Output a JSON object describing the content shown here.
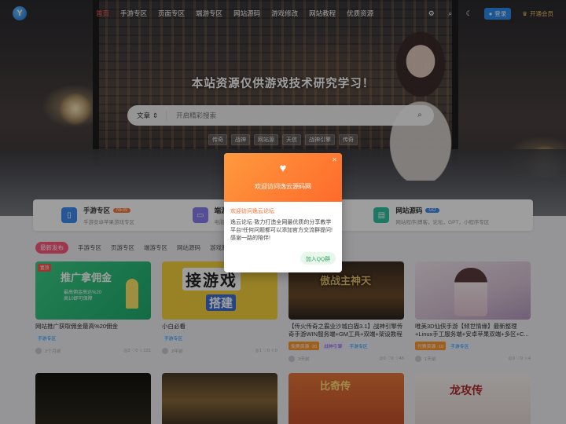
{
  "header": {
    "nav": [
      "首页",
      "手游专区",
      "页面专区",
      "端游专区",
      "网站源码",
      "游戏修改",
      "网站教程",
      "优质资源"
    ],
    "login_label": "登录",
    "vip_label": "开通会员"
  },
  "hero": {
    "slogan": "本站资源仅供游戏技术研究学习！",
    "search_type": "文章",
    "search_placeholder": "开启精彩搜索",
    "hot_tags": [
      "传奇",
      "战神",
      "网站源",
      "天信",
      "战神引擎",
      "传奇"
    ]
  },
  "categories": [
    {
      "title": "手游专区",
      "badge": "NEW",
      "sub": "手游安卓苹果游戏专区",
      "icon": "phone-icon",
      "color": "#3c8cf0",
      "badge_color": "#ff7a3a"
    },
    {
      "title": "端游专区",
      "badge": "",
      "sub": "电脑pc端游专区",
      "icon": "monitor-icon",
      "color": "#8a7cf0",
      "badge_color": ""
    },
    {
      "title": "网站源码",
      "badge": "GO",
      "sub": "网站程序|博客，论坛，GPT，小程序专区",
      "icon": "code-icon",
      "color": "#2fc4a0",
      "badge_color": "#3c8cf0"
    }
  ],
  "tabs": [
    "最新发布",
    "手游专区",
    "页游专区",
    "端游专区",
    "网站源码",
    "游戏教程"
  ],
  "posts": [
    {
      "badge": "置顶",
      "thumb_text": "推广拿佣金",
      "thumb_sub": "最高佣金高达%20\n高10即可保障",
      "title": "网站推广获取佣金最高%20佣金",
      "tags": [
        {
          "text": "手游专区",
          "style": "blue"
        }
      ],
      "author": "2个月前",
      "stats": "◎3 ♡0 ☆131"
    },
    {
      "badge": "",
      "thumb_text": "接游戏",
      "thumb_sub": "搭建",
      "title": "小白必看",
      "tags": [
        {
          "text": "手游专区",
          "style": "blue"
        }
      ],
      "author": "2年前",
      "stats": "◎1 ♡0 ☆0"
    },
    {
      "badge": "",
      "thumb_text": "傲战主神天",
      "thumb_sub": "",
      "title": "【传火传奇之霸业沙城白猫3.1】战神引擎传奇手游WIN服务端+GM工具+双端+架设教程",
      "tags": [
        {
          "text": "免费资源 ·20",
          "style": "orange"
        },
        {
          "text": "战神引擎",
          "style": "purple"
        },
        {
          "text": "手游专区",
          "style": "blue"
        }
      ],
      "author": "3天前",
      "stats": "◎0 ♡0 ☆45"
    },
    {
      "badge": "",
      "thumb_text": "",
      "thumb_sub": "",
      "title": "唯美3D仙侠手游【倾世情缘】最新整理+Linux手工服务端+安卓苹果双端+多区+C...",
      "tags": [
        {
          "text": "付费资源 ·10",
          "style": "orange"
        },
        {
          "text": "手游专区",
          "style": "blue"
        }
      ],
      "author": "1天前",
      "stats": "◎0 ♡0 ☆4"
    },
    {
      "badge": "",
      "thumb_text": "",
      "thumb_sub": "",
      "title": "",
      "tags": [],
      "author": "",
      "stats": ""
    },
    {
      "badge": "",
      "thumb_text": "",
      "thumb_sub": "",
      "title": "",
      "tags": [],
      "author": "",
      "stats": ""
    },
    {
      "badge": "",
      "thumb_text": "比奇传",
      "thumb_sub": "",
      "title": "",
      "tags": [],
      "author": "",
      "stats": ""
    },
    {
      "badge": "",
      "thumb_text": "龙攻传",
      "thumb_sub": "",
      "title": "",
      "tags": [],
      "author": "",
      "stats": ""
    }
  ],
  "modal": {
    "title": "欢迎访问逸云源码网",
    "subtitle": "欢迎访问逸云论坛",
    "text": "逸云论坛·致力打造全网最优质的分享教学平台!任何问题都可以添加官方交流群提问!感谢一路的陪伴!",
    "button_label": "加入QQ群"
  },
  "colors": {
    "accent": "#ff6a2b",
    "brand_blue": "#2d8cf0",
    "nav_active": "#ff5a4e"
  }
}
